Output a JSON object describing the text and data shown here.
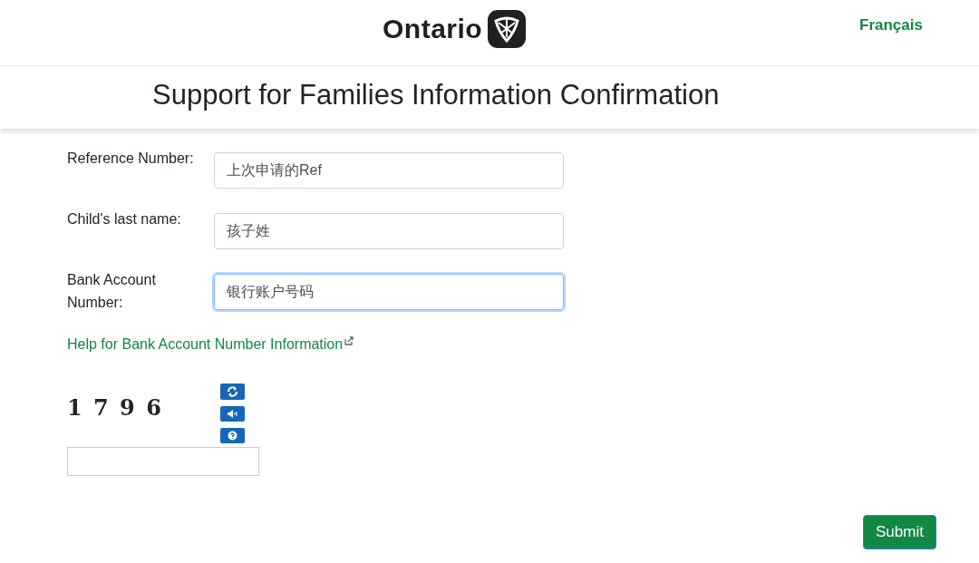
{
  "header": {
    "logo_text": "Ontario",
    "language_link": "Français"
  },
  "title": "Support for Families Information Confirmation",
  "fields": [
    {
      "label": "Reference Number:",
      "value": "上次申请的Ref",
      "focused": false
    },
    {
      "label": "Child's last name:",
      "value": "孩子姓",
      "focused": false
    },
    {
      "label": "Bank Account Number:",
      "value": "银行账户号码",
      "focused": true
    }
  ],
  "help_link": "Help for Bank Account Number Information",
  "captcha": {
    "code": "1 7 9 6"
  },
  "submit": "Submit"
}
